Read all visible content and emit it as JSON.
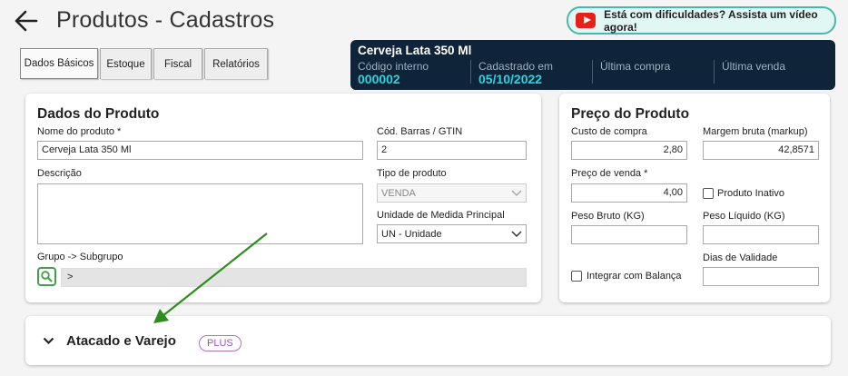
{
  "header": {
    "title": "Produtos - Cadastros",
    "help_button": "Está com dificuldades? Assista um vídeo agora!"
  },
  "tabs": [
    {
      "label": "Dados Básicos",
      "active": true
    },
    {
      "label": "Estoque",
      "active": false
    },
    {
      "label": "Fiscal",
      "active": false
    },
    {
      "label": "Relatórios",
      "active": false
    }
  ],
  "info_panel": {
    "product_name": "Cerveja Lata 350 Ml",
    "codigo_label": "Código interno",
    "codigo_value": "000002",
    "cadastrado_label": "Cadastrado em",
    "cadastrado_value": "05/10/2022",
    "ultima_compra_label": "Última compra",
    "ultima_venda_label": "Última venda"
  },
  "dados_produto": {
    "title": "Dados do Produto",
    "nome_label": "Nome do produto *",
    "nome_value": "Cerveja Lata 350 Ml",
    "barras_label": "Cód. Barras / GTIN",
    "barras_value": "2",
    "descricao_label": "Descrição",
    "descricao_value": "",
    "tipo_label": "Tipo de produto",
    "tipo_value": "VENDA",
    "unidade_label": "Unidade de Medida Principal",
    "unidade_value": "UN - Unidade",
    "grupo_label": "Grupo -> Subgrupo",
    "grupo_value": ">"
  },
  "preco_produto": {
    "title": "Preço do Produto",
    "custo_label": "Custo de compra",
    "custo_value": "2,80",
    "margem_label": "Margem bruta (markup)",
    "margem_value": "42,8571",
    "venda_label": "Preço de venda *",
    "venda_value": "4,00",
    "inativo_label": "Produto Inativo",
    "peso_bruto_label": "Peso Bruto (KG)",
    "peso_bruto_value": "",
    "peso_liquido_label": "Peso Líquido (KG)",
    "peso_liquido_value": "",
    "dias_validade_label": "Dias de Validade",
    "dias_validade_value": "",
    "balanca_label": "Integrar com Balança"
  },
  "atacado": {
    "title": "Atacado e Varejo",
    "badge": "PLUS"
  },
  "colors": {
    "info_bg": "#0f2438",
    "info_value": "#2ad3e0",
    "help_border": "#4db6ac",
    "arrow": "#2e8b1e",
    "plus_badge": "#a050c0"
  }
}
